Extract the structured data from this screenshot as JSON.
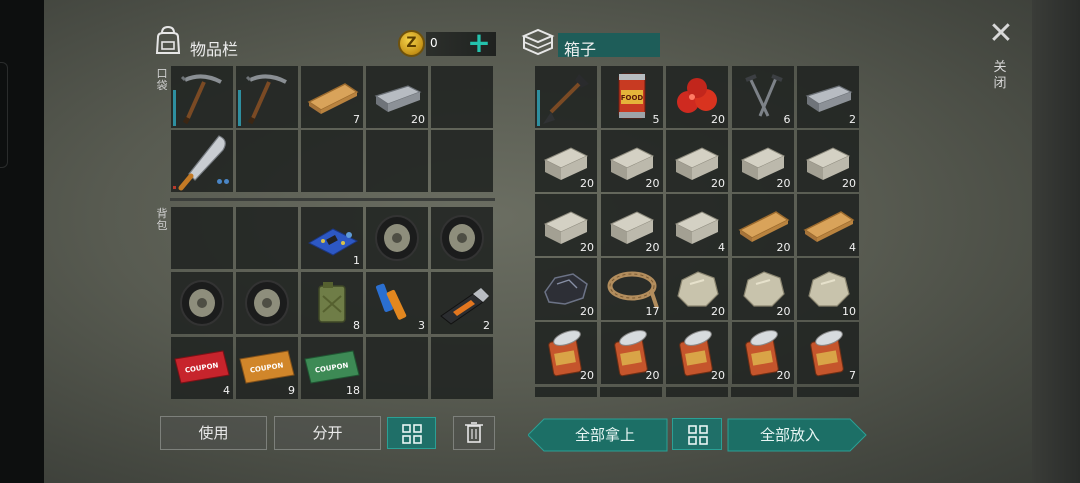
{
  "inventory": {
    "title": "物品栏",
    "coin_symbol": "Z",
    "coin_count": "0",
    "add_label": "+",
    "pocket_label": "口袋",
    "backpack_label": "背包",
    "pocket_slots": [
      {
        "icon": "pickaxe-icon",
        "count": ""
      },
      {
        "icon": "pickaxe-icon",
        "count": ""
      },
      {
        "icon": "wooden-plank-icon",
        "count": "7"
      },
      {
        "icon": "iron-ingot-icon",
        "count": "20"
      },
      {
        "icon": "",
        "count": ""
      },
      {
        "icon": "machete-icon",
        "count": ""
      },
      {
        "icon": "",
        "count": ""
      },
      {
        "icon": "",
        "count": ""
      },
      {
        "icon": "",
        "count": ""
      },
      {
        "icon": "",
        "count": ""
      }
    ],
    "backpack_slots": [
      {
        "icon": "",
        "count": ""
      },
      {
        "icon": "",
        "count": ""
      },
      {
        "icon": "circuit-board-icon",
        "count": "1"
      },
      {
        "icon": "wheel-icon",
        "count": ""
      },
      {
        "icon": "wheel-icon",
        "count": ""
      },
      {
        "icon": "wheel-icon",
        "count": ""
      },
      {
        "icon": "wheel-icon",
        "count": ""
      },
      {
        "icon": "jerry-can-icon",
        "count": "8"
      },
      {
        "icon": "battery-icon",
        "count": "3"
      },
      {
        "icon": "usb-drive-icon",
        "count": "2"
      },
      {
        "icon": "red-coupon-icon",
        "count": "4",
        "text": "COUPON"
      },
      {
        "icon": "orange-coupon-icon",
        "count": "9",
        "text": "COUPON"
      },
      {
        "icon": "green-coupon-icon",
        "count": "18",
        "text": "COUPON"
      },
      {
        "icon": "",
        "count": ""
      },
      {
        "icon": "",
        "count": ""
      }
    ],
    "buttons": {
      "use": "使用",
      "split": "分开"
    }
  },
  "box": {
    "title": "箱子",
    "slots": [
      {
        "icon": "shovel-icon",
        "count": ""
      },
      {
        "icon": "food-can-icon",
        "count": "5",
        "text": "FOOD"
      },
      {
        "icon": "tomato-icon",
        "count": "20"
      },
      {
        "icon": "nails-icon",
        "count": "6"
      },
      {
        "icon": "iron-ingot-icon",
        "count": "2"
      },
      {
        "icon": "stone-block-icon",
        "count": "20"
      },
      {
        "icon": "stone-block-icon",
        "count": "20"
      },
      {
        "icon": "stone-block-icon",
        "count": "20"
      },
      {
        "icon": "stone-block-icon",
        "count": "20"
      },
      {
        "icon": "stone-block-icon",
        "count": "20"
      },
      {
        "icon": "stone-block-icon",
        "count": "20"
      },
      {
        "icon": "stone-block-icon",
        "count": "20"
      },
      {
        "icon": "stone-block-icon",
        "count": "4"
      },
      {
        "icon": "wooden-plank-icon",
        "count": "20"
      },
      {
        "icon": "wooden-plank-icon",
        "count": "4"
      },
      {
        "icon": "coal-icon",
        "count": "20"
      },
      {
        "icon": "rope-icon",
        "count": "17"
      },
      {
        "icon": "stone-icon",
        "count": "20"
      },
      {
        "icon": "stone-icon",
        "count": "20"
      },
      {
        "icon": "stone-icon",
        "count": "10"
      },
      {
        "icon": "open-can-icon",
        "count": "20"
      },
      {
        "icon": "open-can-icon",
        "count": "20"
      },
      {
        "icon": "open-can-icon",
        "count": "20"
      },
      {
        "icon": "open-can-icon",
        "count": "20"
      },
      {
        "icon": "open-can-icon",
        "count": "7"
      }
    ],
    "buttons": {
      "take_all": "全部拿上",
      "put_all": "全部放入"
    }
  },
  "close_label": "关闭",
  "colors": {
    "accent": "#1c6f66",
    "accent_light": "#24c2ad",
    "slot_bg": "#202321"
  }
}
